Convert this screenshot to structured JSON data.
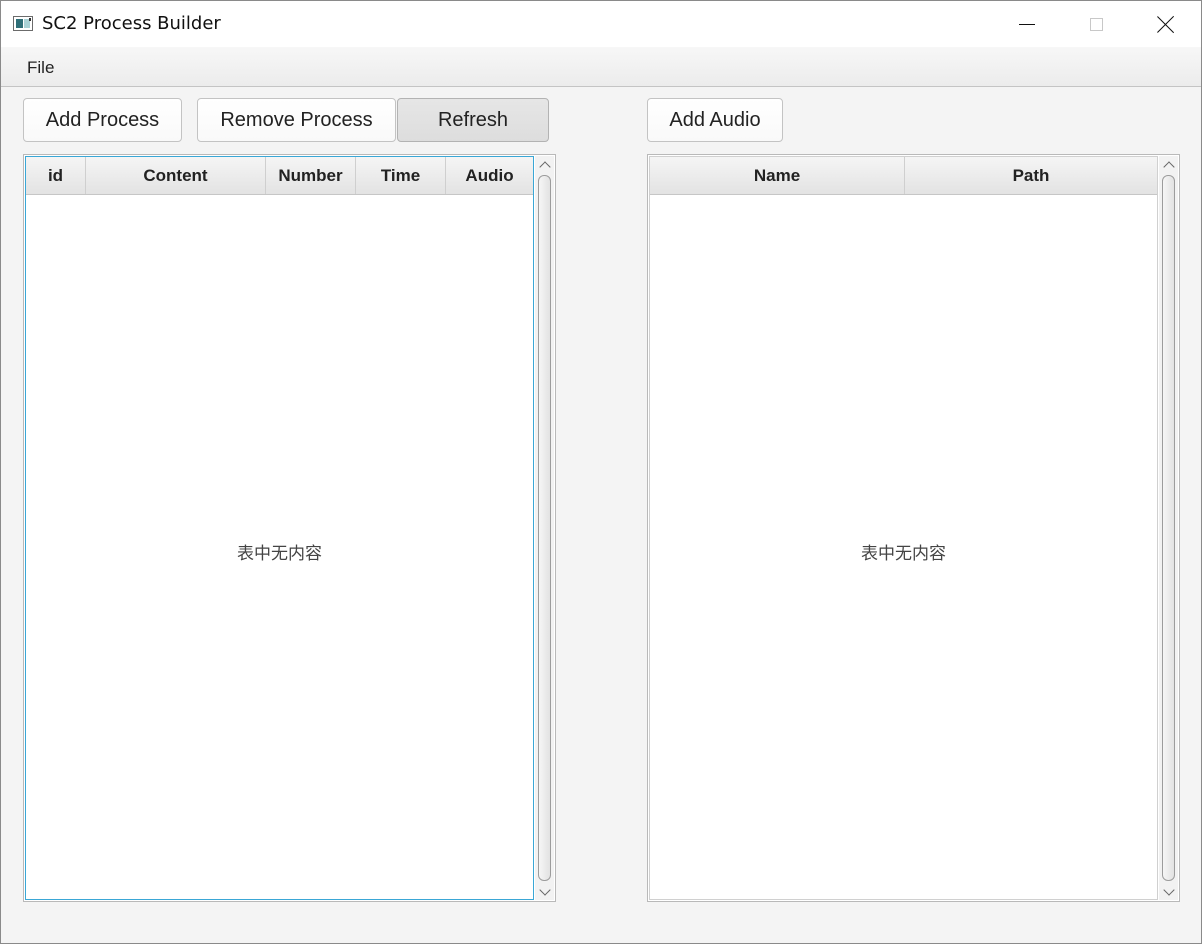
{
  "window": {
    "title": "SC2 Process Builder"
  },
  "menubar": {
    "items": [
      {
        "label": "File"
      }
    ]
  },
  "toolbar": {
    "add_process_label": "Add Process",
    "remove_process_label": "Remove Process",
    "refresh_label": "Refresh",
    "add_audio_label": "Add Audio"
  },
  "process_table": {
    "columns": [
      "id",
      "Content",
      "Number",
      "Time",
      "Audio"
    ],
    "rows": [],
    "empty_text": "表中无内容"
  },
  "audio_table": {
    "columns": [
      "Name",
      "Path"
    ],
    "rows": [],
    "empty_text": "表中无内容"
  },
  "icons": {
    "app": "app-window-icon",
    "minimize": "minimize-icon",
    "maximize": "maximize-icon",
    "close": "close-icon",
    "scroll_up": "chevron-up-icon",
    "scroll_down": "chevron-down-icon"
  },
  "colors": {
    "focus_border": "#3aa7d6",
    "window_bg": "#f4f4f4"
  }
}
